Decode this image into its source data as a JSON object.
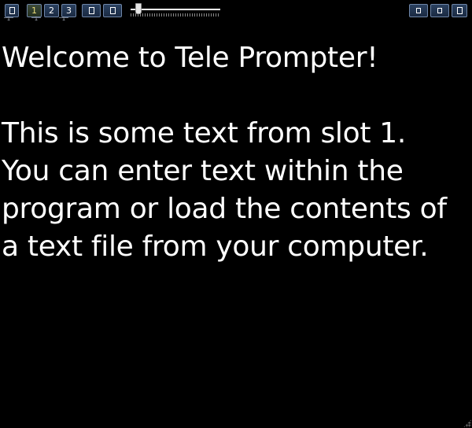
{
  "toolbar": {
    "left_buttons": [
      {
        "name": "menu-button",
        "icon": "square-icon"
      },
      {
        "name": "slot-1-button",
        "label": "1",
        "active": true
      },
      {
        "name": "slot-2-button",
        "label": "2"
      },
      {
        "name": "slot-3-button",
        "label": "3"
      },
      {
        "name": "edit-button",
        "icon": "square-icon"
      },
      {
        "name": "load-file-button",
        "icon": "square-icon"
      }
    ],
    "slot_marks": [
      "1",
      "1",
      "1"
    ],
    "speed_slider": {
      "value": 0.09
    },
    "right_buttons": [
      {
        "name": "minimize-button",
        "icon": "square-icon"
      },
      {
        "name": "maximize-button",
        "icon": "square-icon"
      },
      {
        "name": "close-button",
        "icon": "square-icon"
      }
    ]
  },
  "prompt": {
    "lines": [
      "Welcome to Tele Prompter!",
      "",
      "This is some text from slot 1.",
      "You can enter text within the",
      "program or load the contents of",
      "a text file from your computer."
    ]
  },
  "colors": {
    "background": "#000000",
    "text": "#ffffff",
    "button_fill": "#1f3150",
    "button_border": "#6f86a8",
    "active_label": "#e8dc7a"
  }
}
